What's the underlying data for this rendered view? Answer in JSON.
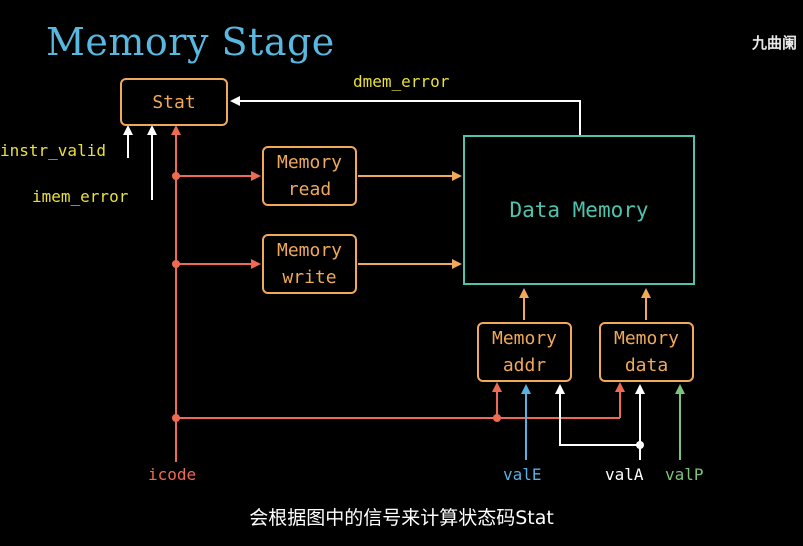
{
  "title": "Memory Stage",
  "watermark": "九曲阑",
  "subtitle": "会根据图中的信号来计算状态码Stat",
  "boxes": {
    "stat": "Stat",
    "mem_read": [
      "Memory",
      "read"
    ],
    "mem_write": [
      "Memory",
      "write"
    ],
    "mem_addr": [
      "Memory",
      "addr"
    ],
    "mem_data": [
      "Memory",
      "data"
    ],
    "data_memory": "Data Memory"
  },
  "signals": {
    "dmem_error": "dmem_error",
    "instr_valid": "instr_valid",
    "imem_error": "imem_error",
    "icode": "icode",
    "valE": "valE",
    "valA": "valA",
    "valP": "valP"
  },
  "colors": {
    "title": "#59b8df",
    "box": "#f0a95a",
    "data_memory": "#4fc3ad",
    "icode_wire": "#ee6a52",
    "signal_yellow": "#e8e03c",
    "valE": "#5ab0e0",
    "valP": "#7cc47c"
  }
}
